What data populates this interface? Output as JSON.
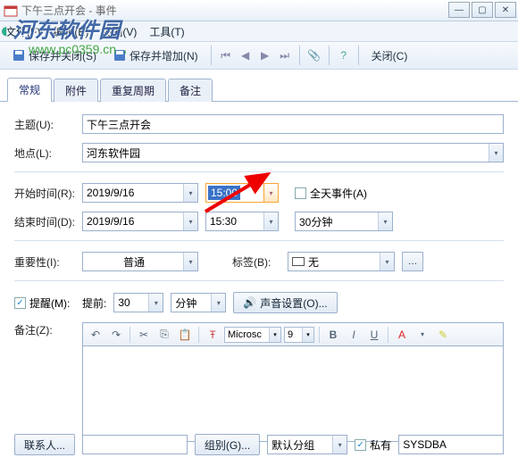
{
  "window": {
    "title": "下午三点开会 - 事件"
  },
  "menu": {
    "file": "文件(F)",
    "edit": "编辑(E)",
    "view": "视图(V)",
    "tools": "工具(T)"
  },
  "toolbar": {
    "save_close": "保存并关闭(S)",
    "save_add": "保存并增加(N)",
    "close": "关闭(C)"
  },
  "tabs": {
    "general": "常规",
    "attach": "附件",
    "recur": "重复周期",
    "notes": "备注"
  },
  "labels": {
    "subject": "主题(U):",
    "location": "地点(L):",
    "start": "开始时间(R):",
    "end": "结束时间(D):",
    "allday": "全天事件(A)",
    "importance": "重要性(I):",
    "tag": "标签(B):",
    "remind": "提醒(M):",
    "before": "提前:",
    "remark": "备注(Z):",
    "contacts": "联系人...",
    "group": "组别(G)...",
    "private": "私有",
    "sound": "声音设置(O)..."
  },
  "values": {
    "subject": "下午三点开会",
    "location": "河东软件园",
    "start_date": "2019/9/16",
    "start_time": "15:00",
    "end_date": "2019/9/16",
    "end_time": "15:30",
    "duration": "30分钟",
    "importance": "普通",
    "tag": "无",
    "remind_value": "30",
    "remind_unit": "分钟",
    "font_name": "Microsc",
    "font_size": "9",
    "group_default": "默认分组",
    "owner": "SYSDBA"
  },
  "watermark": {
    "text": "河东软件园",
    "url": "www.pc0359.cn"
  }
}
